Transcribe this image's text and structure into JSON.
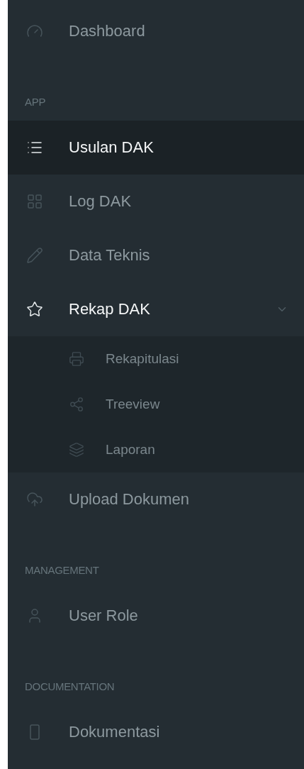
{
  "menu": [
    {
      "kind": "item",
      "label": "Dashboard",
      "selected": false
    },
    {
      "kind": "header",
      "label": "APP"
    },
    {
      "kind": "item",
      "label": "Usulan DAK",
      "selected": true
    },
    {
      "kind": "item",
      "label": "Log DAK",
      "selected": false
    },
    {
      "kind": "item",
      "label": "Data Teknis",
      "selected": false
    },
    {
      "kind": "item",
      "label": "Rekap DAK",
      "selected": false,
      "expanded": true,
      "children": [
        {
          "label": "Rekapitulasi",
          "selected": false
        },
        {
          "label": "Treeview",
          "selected": false
        },
        {
          "label": "Laporan",
          "selected": false
        }
      ]
    },
    {
      "kind": "item",
      "label": "Upload Dokumen",
      "selected": false
    },
    {
      "kind": "header",
      "label": "MANAGEMENT"
    },
    {
      "kind": "item",
      "label": "User Role",
      "selected": false
    },
    {
      "kind": "header",
      "label": "DOCUMENTATION"
    },
    {
      "kind": "item",
      "label": "Dokumentasi",
      "selected": false
    }
  ]
}
